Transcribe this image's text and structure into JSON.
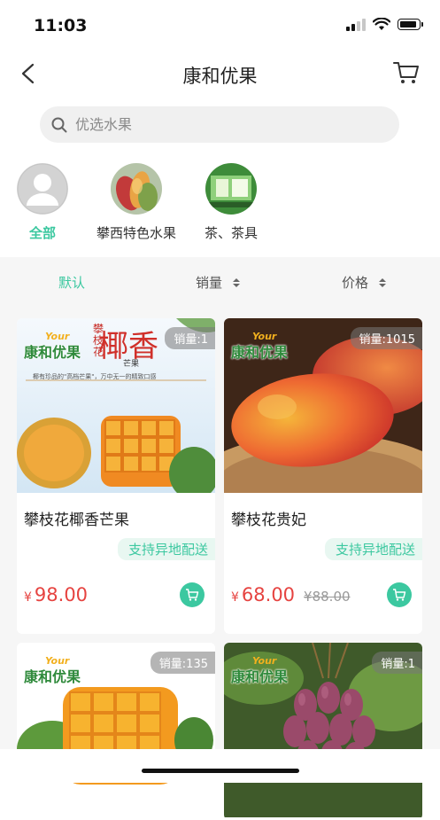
{
  "status": {
    "time": "11:03"
  },
  "nav": {
    "title": "康和优果"
  },
  "search": {
    "placeholder": "优选水果"
  },
  "categories": [
    {
      "label": "全部",
      "active": true
    },
    {
      "label": "攀西特色水果",
      "active": false
    },
    {
      "label": "茶、茶具",
      "active": false
    }
  ],
  "sort": {
    "default": "默认",
    "sales": "销量",
    "price": "价格"
  },
  "products": [
    {
      "name": "攀枝花椰香芒果",
      "sales": "销量:1",
      "tag": "支持异地配送",
      "currency": "¥",
      "price": "98.00",
      "old_price": ""
    },
    {
      "name": "攀枝花贵妃",
      "sales": "销量:1015",
      "tag": "支持异地配送",
      "currency": "¥",
      "price": "68.00",
      "old_price": "¥88.00"
    },
    {
      "name": "",
      "sales": "销量:135",
      "tag": "",
      "currency": "",
      "price": "",
      "old_price": ""
    },
    {
      "name": "",
      "sales": "销量:1",
      "tag": "",
      "currency": "",
      "price": "",
      "old_price": ""
    }
  ],
  "banner": {
    "poster_title": "椰香",
    "poster_sub": "芒果",
    "poster_top": "攀枝花",
    "poster_line": "椰有珍品的\"高档芒果\"，万中无一的精致口感",
    "brand_en": "Your",
    "brand_cn": "康和优果"
  },
  "colors": {
    "accent": "#3cc8a0",
    "price": "#e64340"
  }
}
